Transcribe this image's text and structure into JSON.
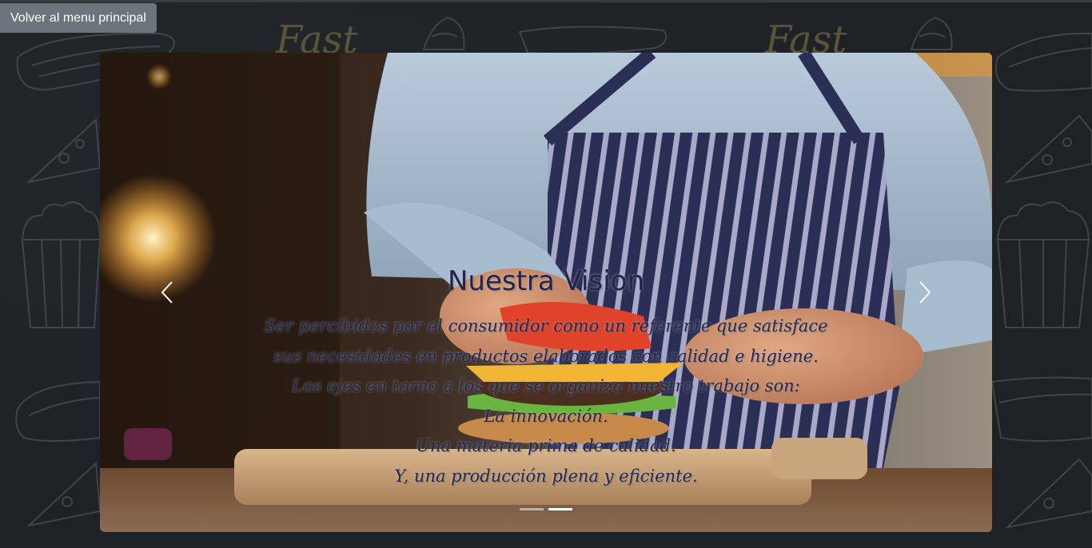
{
  "back_button": {
    "label": "Volver al menu principal"
  },
  "background": {
    "wordmark": "Fast",
    "color": "#1e2226",
    "doodle_color": "#5b6066"
  },
  "carousel": {
    "slide": {
      "title": "Nuestra Vision",
      "lines": [
        "Ser percibidos por el consumidor como un referente que satisface",
        "sus necesidades en productos elaborados con calidad e higiene.",
        "Los ejes en torno a los que se organiza nuestro trabajo son:",
        "La innovación.",
        "Una materia prima de calidad.",
        "Y, una producción plena y eficiente."
      ],
      "title_color": "#20244f"
    },
    "prev_icon": "chevron-left-icon",
    "next_icon": "chevron-right-icon",
    "indicators": {
      "count": 2,
      "active_index": 1
    }
  }
}
